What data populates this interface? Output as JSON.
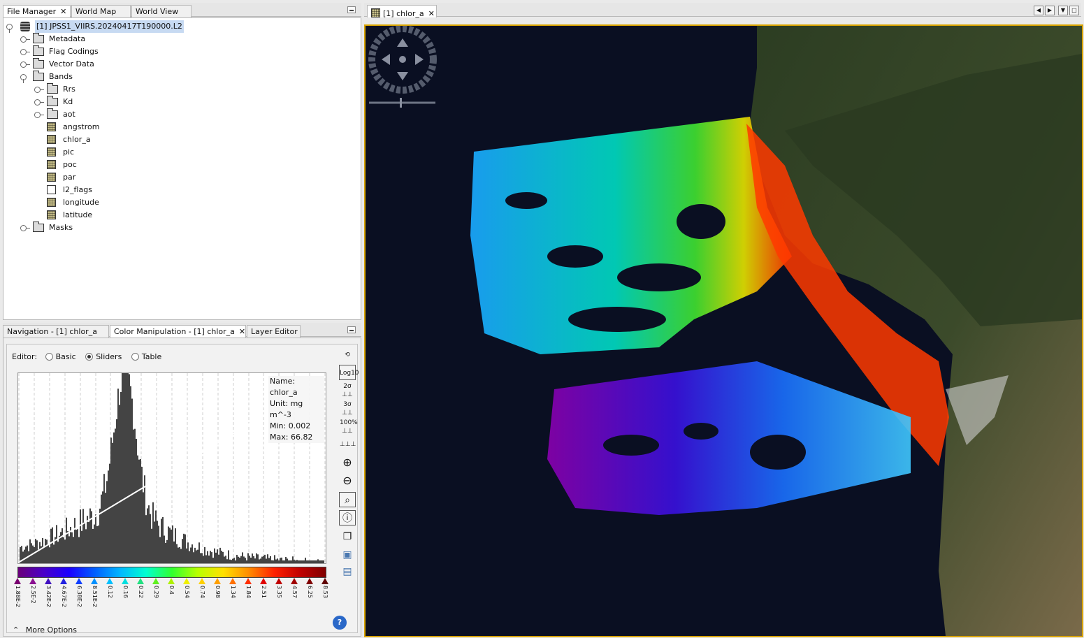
{
  "left_tabs": [
    "File Manager",
    "World Map",
    "World View"
  ],
  "tree": {
    "root": "[1] JPSS1_VIIRS.20240417T190000.L2",
    "groups": [
      "Metadata",
      "Flag Codings",
      "Vector Data",
      "Bands"
    ],
    "band_folders": [
      "Rrs",
      "Kd",
      "aot"
    ],
    "bands": [
      "angstrom",
      "chlor_a",
      "pic",
      "poc",
      "par",
      "l2_flags",
      "longitude",
      "latitude"
    ],
    "masks": "Masks"
  },
  "bottom_tabs": [
    "Navigation - [1] chlor_a",
    "Color Manipulation - [1] chlor_a",
    "Layer Editor"
  ],
  "editor": {
    "label": "Editor:",
    "options": [
      "Basic",
      "Sliders",
      "Table"
    ],
    "selected": "Sliders"
  },
  "histogram_info": {
    "name": "Name: chlor_a",
    "unit": "Unit: mg m^-3",
    "min": "Min: 0.002",
    "max": "Max: 66.82"
  },
  "tools": [
    "reset-icon",
    "log10-icon",
    "2σ",
    "3σ",
    "100%",
    "distribute-icon",
    "zoom-in-icon",
    "zoom-out-icon",
    "zoom-horizontal-icon",
    "info-icon",
    "multi-apply-icon",
    "import-icon",
    "export-icon"
  ],
  "tool_labels": {
    "log": "Log10",
    "s2": "2σ",
    "s3": "3σ",
    "p100": "100%"
  },
  "slider_ticks": [
    "1.88E-2",
    "2.5E-2",
    "3.42E-2",
    "4.67E-2",
    "6.38E-2",
    "8.51E-2",
    "0.12",
    "0.16",
    "0.22",
    "0.29",
    "0.4",
    "0.54",
    "0.74",
    "0.98",
    "1.34",
    "1.84",
    "2.51",
    "3.35",
    "4.57",
    "6.25",
    "8.53"
  ],
  "more_options": "More Options",
  "image_tab": "[1] chlor_a",
  "colors": {
    "accent": "#d9a400",
    "map_bg": "#0a0f22"
  }
}
